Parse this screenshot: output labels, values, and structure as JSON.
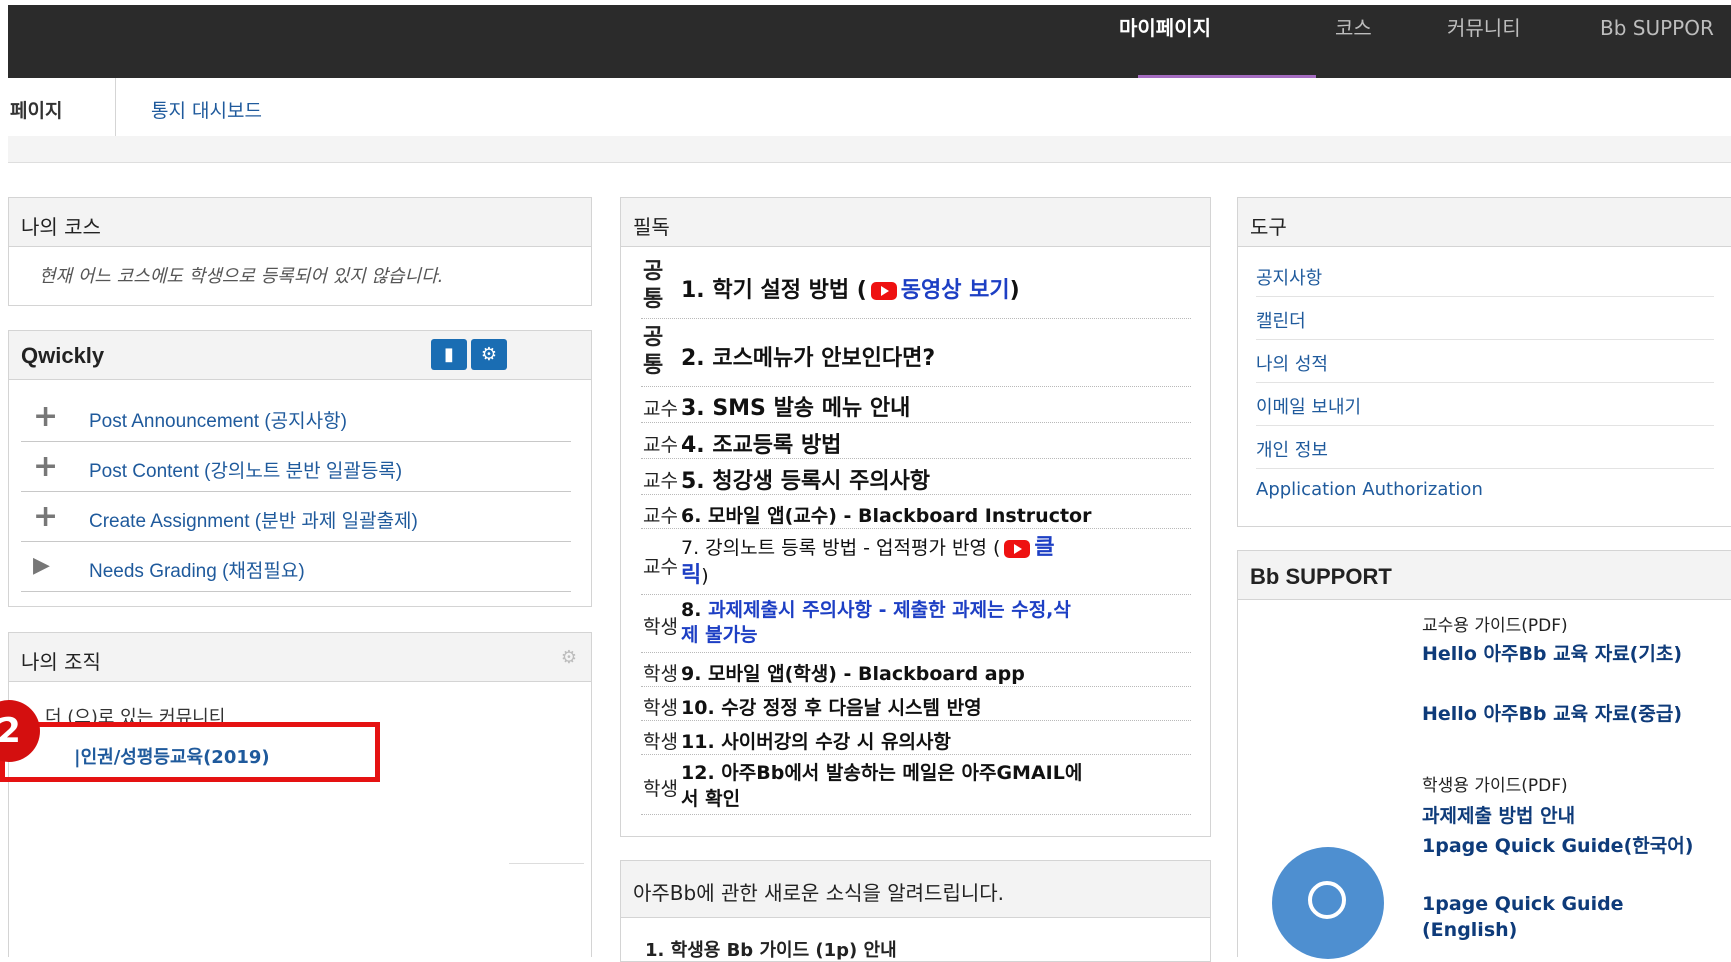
{
  "topnav": {
    "items": [
      "마이페이지",
      "코스",
      "커뮤니티",
      "Bb SUPPOR"
    ]
  },
  "subnav": {
    "page": "페이지",
    "dashboard": "통지 대시보드"
  },
  "my_courses": {
    "title": "나의 코스",
    "empty": "현재 어느 코스에도 학생으로 등록되어 있지 않습니다."
  },
  "qwickly": {
    "title": "Qwickly",
    "actions": [
      {
        "icon": "plus-icon",
        "label": "Post Announcement (공지사항)"
      },
      {
        "icon": "plus-icon",
        "label": "Post Content (강의노트 분반 일괄등록)"
      },
      {
        "icon": "plus-icon",
        "label": "Create Assignment (분반 과제 일괄출제)"
      },
      {
        "icon": "play-icon",
        "label": "Needs Grading (채점필요)"
      }
    ]
  },
  "my_org": {
    "title": "나의 조직",
    "lead": "더 (으)로 있는 커뮤니티",
    "org": "|인권/성평등교육(2019)",
    "callout": "2"
  },
  "required": {
    "title": "필독",
    "rows": [
      {
        "tag": "공통",
        "text": "1. 학기 설정 방법 (",
        "link": "동영상 보기",
        "tail": ")"
      },
      {
        "tag": "공통",
        "text": "2. 코스메뉴가 안보인다면?"
      },
      {
        "tag": "교수",
        "text": "3.  SMS 발송 메뉴 안내"
      },
      {
        "tag": "교수",
        "text": "4. 조교등록 방법"
      },
      {
        "tag": "교수",
        "text": "5. 청강생 등록시 주의사항"
      },
      {
        "tag": "교수",
        "text": "6. 모바일 앱(교수) - Blackboard Instructor"
      },
      {
        "tag": "교수",
        "text": "7. 강의노트 등록 방법 - 업적평가 반영 (",
        "link": "클",
        "link2": "릭",
        "tail": ")"
      },
      {
        "tag": "학생",
        "text1": "8. ",
        "link": "과제제출시 주의사항  - 제출한 과제는 수정,삭",
        "link2": "제 불가능"
      },
      {
        "tag": "학생",
        "text": "9. 모바일 앱(학생) - Blackboard app"
      },
      {
        "tag": "학생",
        "text": "10. 수강 정정 후 다음날 시스템 반영"
      },
      {
        "tag": "학생",
        "text": "11. 사이버강의 수강 시 유의사항"
      },
      {
        "tag": "학생",
        "line1": "12. 아주Bb에서 발송하는 메일은 아주GMAIL에",
        "line2": "서 확인"
      }
    ]
  },
  "news": {
    "title": "아주Bb에 관한 새로운 소식을 알려드립니다.",
    "item1": "1. 학생용 Bb 가이드 (1p) 안내"
  },
  "tools": {
    "title": "도구",
    "items": [
      "공지사항",
      "캘린더",
      "나의 성적",
      "이메일 보내기",
      "개인 정보",
      "Application Authorization"
    ]
  },
  "bb_support": {
    "title": "Bb SUPPORT",
    "prof_guide": "교수용 가이드(PDF)",
    "hello_basic": "Hello 아주Bb 교육 자료(기초)",
    "hello_mid": "Hello 아주Bb 교육 자료(중급)",
    "student_guide": "학생용 가이드(PDF)",
    "submit_guide": "과제제출 방법 안내",
    "quick_ko": "1page Quick Guide(한국어)",
    "quick_en": "1page Quick Guide (English)"
  },
  "colors": {
    "topbar": "#2b2b2b",
    "accent_underline": "#a56cc1",
    "link": "#1f5a9c",
    "highlight_red": "#e51212",
    "required_blue": "#1d3fc4",
    "required_purple": "#9a2d86"
  }
}
